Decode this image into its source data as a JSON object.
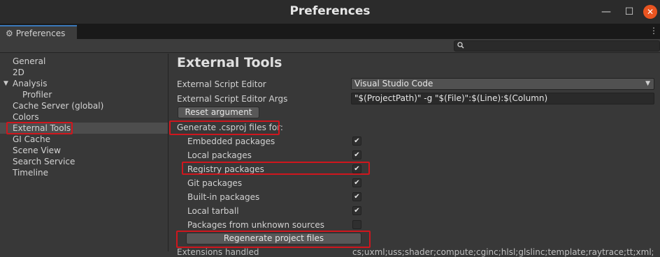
{
  "window": {
    "title": "Preferences",
    "tab_label": "Preferences"
  },
  "sidebar": {
    "items": [
      {
        "label": "General"
      },
      {
        "label": "2D"
      },
      {
        "label": "Analysis"
      },
      {
        "label": "Profiler"
      },
      {
        "label": "Cache Server (global)"
      },
      {
        "label": "Colors"
      },
      {
        "label": "External Tools"
      },
      {
        "label": "GI Cache"
      },
      {
        "label": "Scene View"
      },
      {
        "label": "Search Service"
      },
      {
        "label": "Timeline"
      }
    ]
  },
  "main": {
    "heading": "External Tools",
    "script_editor_label": "External Script Editor",
    "script_editor_value": "Visual Studio Code",
    "script_editor_args_label": "External Script Editor Args",
    "script_editor_args_value": "\"$(ProjectPath)\" -g \"$(File)\":$(Line):$(Column)",
    "reset_button": "Reset argument",
    "generate_label": "Generate .csproj files for:",
    "packages": [
      {
        "label": "Embedded packages",
        "checked": true
      },
      {
        "label": "Local packages",
        "checked": true
      },
      {
        "label": "Registry packages",
        "checked": true
      },
      {
        "label": "Git packages",
        "checked": true
      },
      {
        "label": "Built-in packages",
        "checked": true
      },
      {
        "label": "Local tarball",
        "checked": true
      },
      {
        "label": "Packages from unknown sources",
        "checked": false
      }
    ],
    "regenerate_button": "Regenerate project files",
    "extensions_label": "Extensions handled",
    "extensions_value": "cs;uxml;uss;shader;compute;cginc;hlsl;glslinc;template;raytrace;tt;xml;fnt;cd;asmdef"
  },
  "colors": {
    "highlight": "#d0161d",
    "close_button": "#e95420"
  }
}
